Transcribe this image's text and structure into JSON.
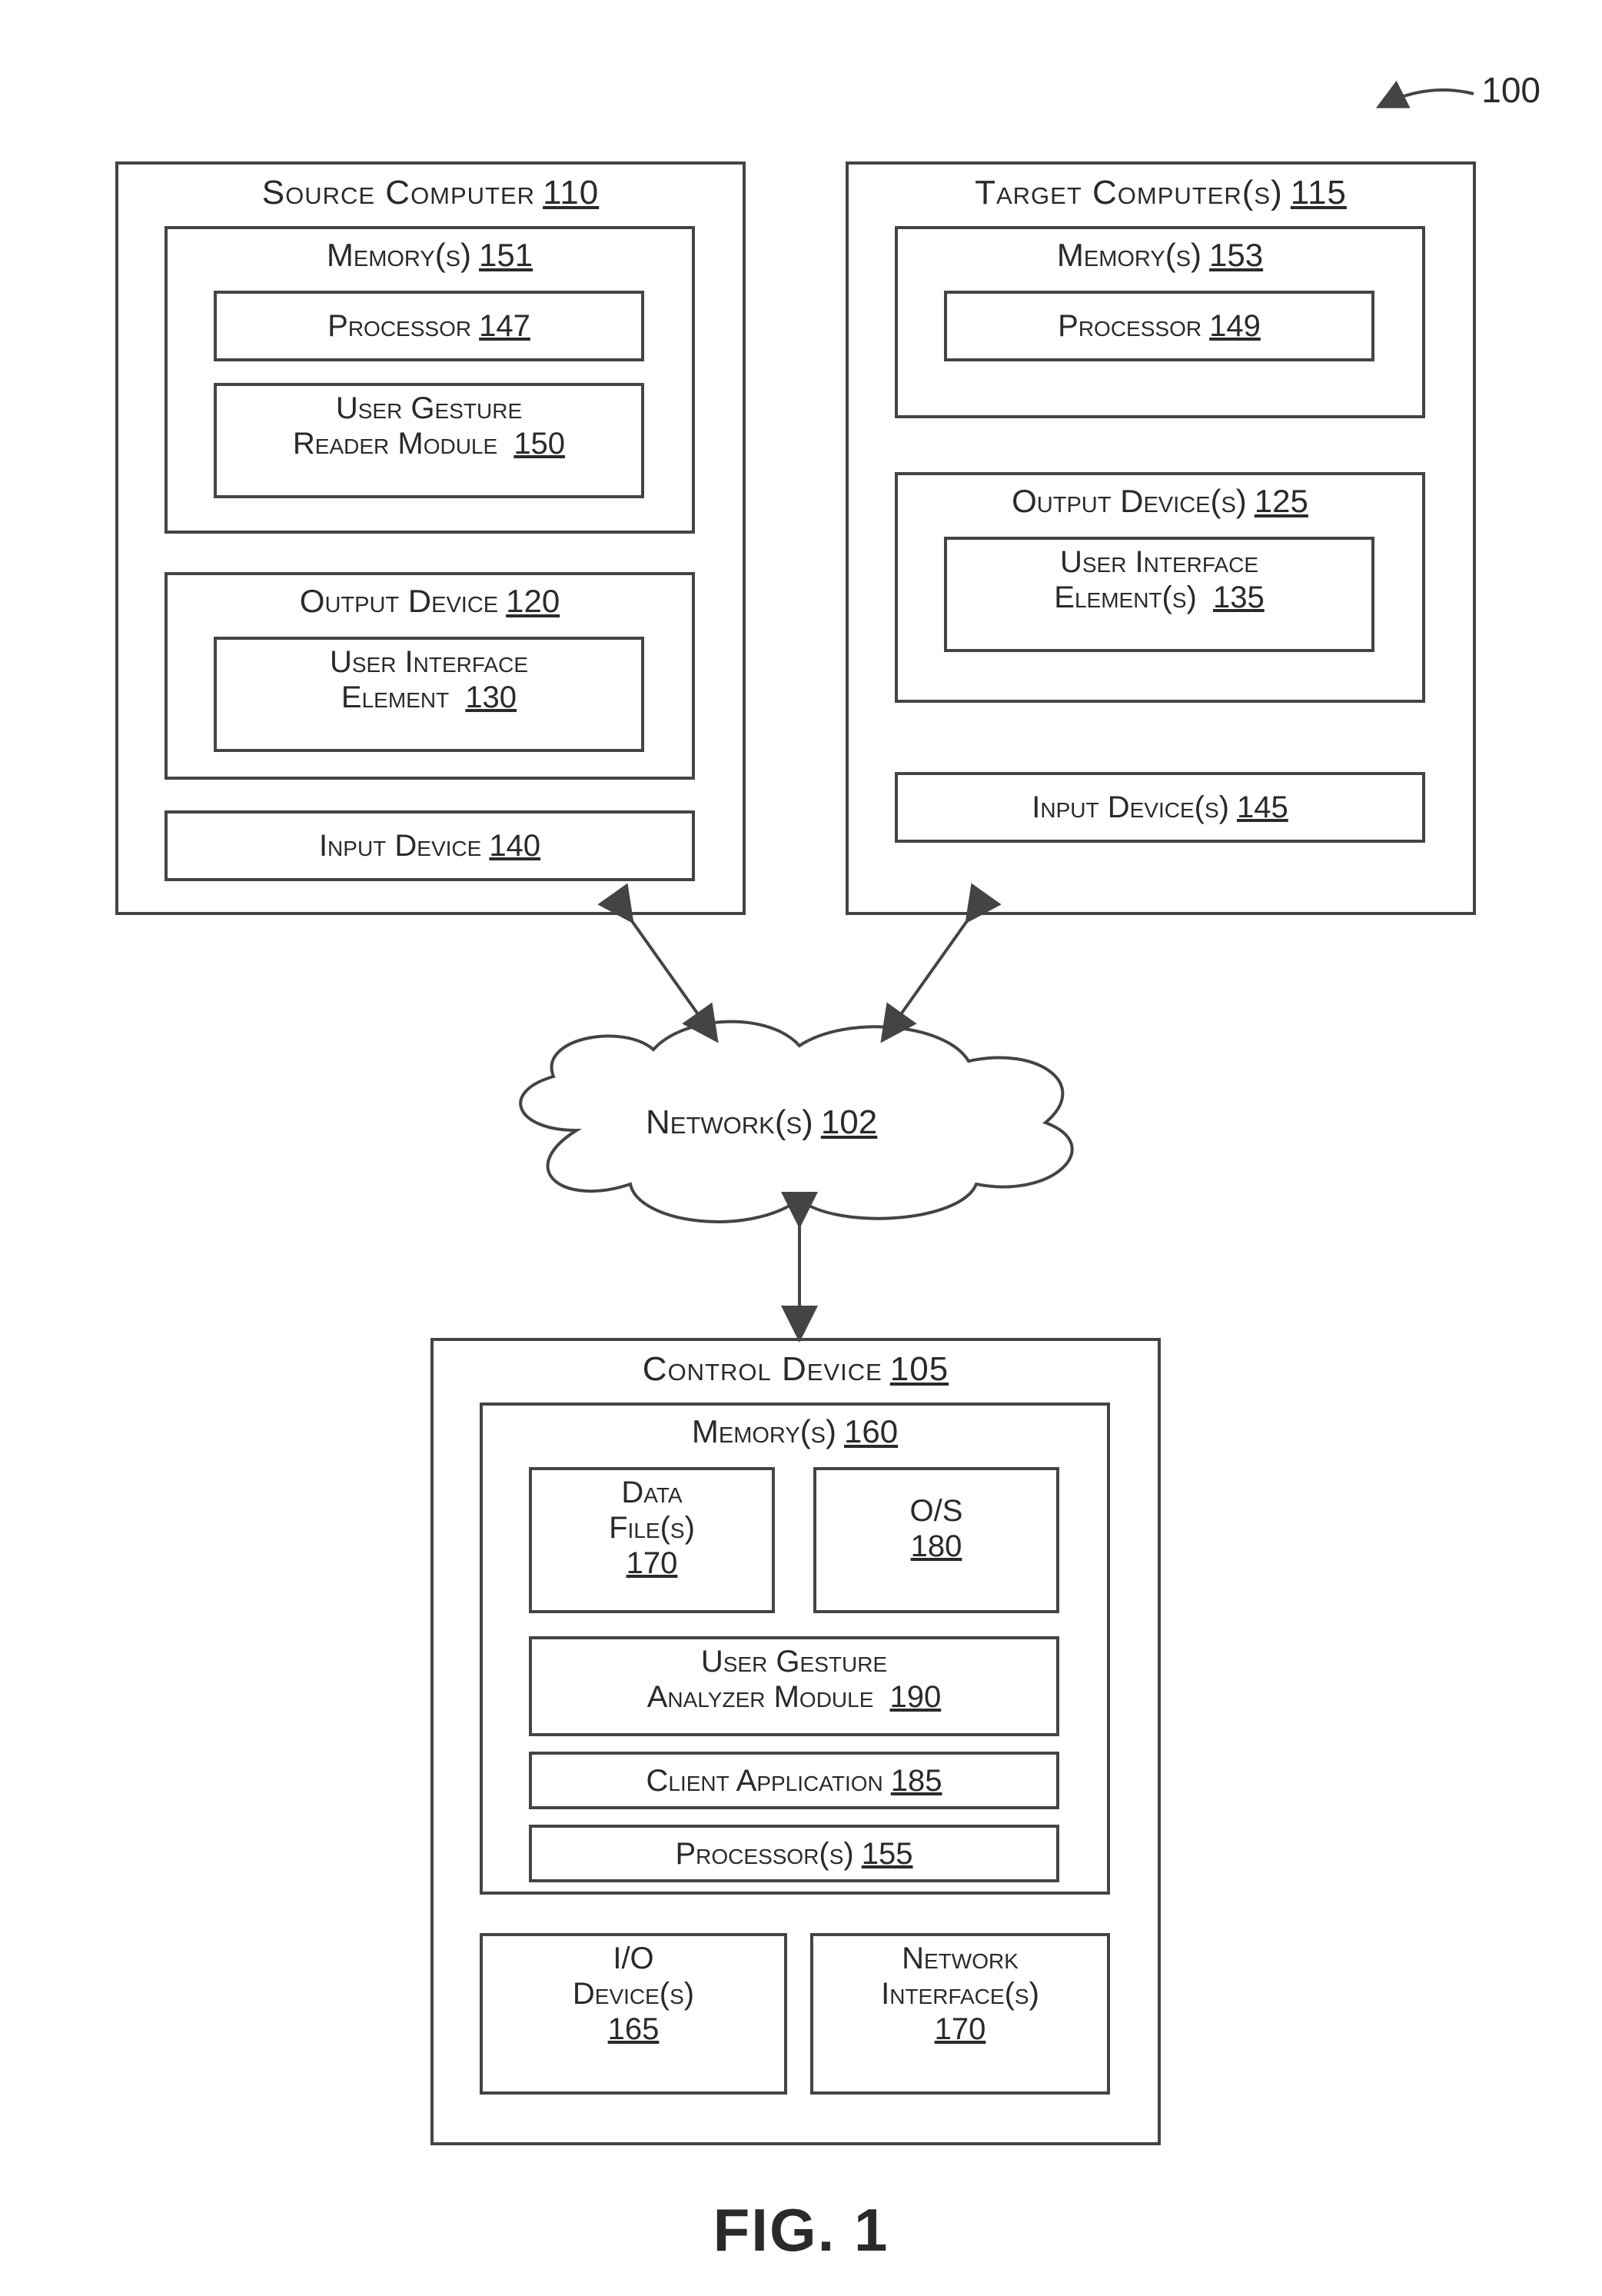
{
  "figure_label": "FIG. 1",
  "system_ref": "100",
  "source_computer": {
    "label": "Source Computer",
    "ref": "110",
    "memorys": {
      "label": "Memory(s)",
      "ref": "151"
    },
    "processor": {
      "label": "Processor",
      "ref": "147"
    },
    "user_gesture_reader": {
      "label1": "User Gesture",
      "label2": "Reader Module",
      "ref": "150"
    },
    "output_device": {
      "label": "Output Device",
      "ref": "120"
    },
    "ui_element": {
      "label1": "User Interface",
      "label2": "Element",
      "ref": "130"
    },
    "input_device": {
      "label": "Input Device",
      "ref": "140"
    }
  },
  "target_computer": {
    "label": "Target Computer(s)",
    "ref": "115",
    "memorys": {
      "label": "Memory(s)",
      "ref": "153"
    },
    "processor": {
      "label": "Processor",
      "ref": "149"
    },
    "output_devices": {
      "label": "Output Device(s)",
      "ref": "125"
    },
    "ui_elements": {
      "label1": "User Interface",
      "label2": "Element(s)",
      "ref": "135"
    },
    "input_devices": {
      "label": "Input Device(s)",
      "ref": "145"
    }
  },
  "network": {
    "label": "Network(s)",
    "ref": "102"
  },
  "control_device": {
    "label": "Control Device",
    "ref": "105",
    "memorys": {
      "label": "Memory(s)",
      "ref": "160"
    },
    "data_files": {
      "label1": "Data",
      "label2": "File(s)",
      "ref": "170"
    },
    "os": {
      "label": "O/S",
      "ref": "180"
    },
    "user_gesture_analyzer": {
      "label1": "User Gesture",
      "label2": "Analyzer Module",
      "ref": "190"
    },
    "client_app": {
      "label": "Client Application",
      "ref": "185"
    },
    "processors": {
      "label": "Processor(s)",
      "ref": "155"
    },
    "io_devices": {
      "label1": "I/O",
      "label2": "Device(s)",
      "ref": "165"
    },
    "network_interfaces": {
      "label1": "Network",
      "label2": "Interface(s)",
      "ref": "170"
    }
  }
}
